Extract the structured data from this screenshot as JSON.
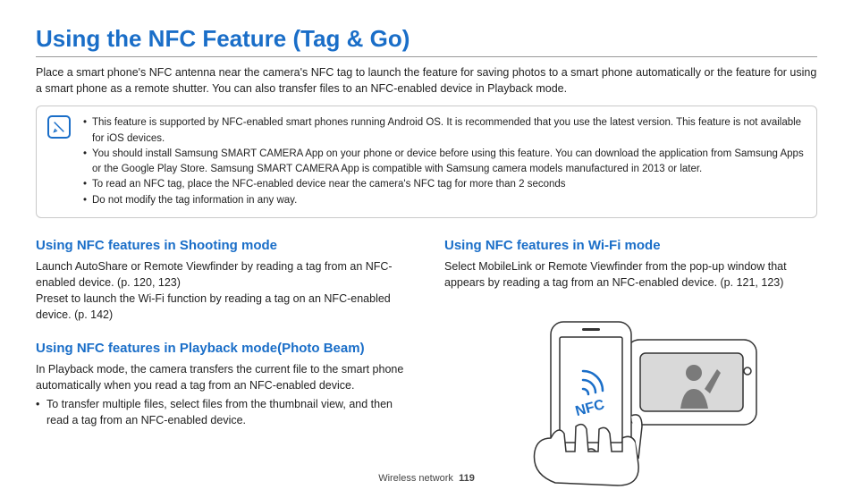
{
  "title": "Using the NFC Feature (Tag & Go)",
  "intro": "Place a smart phone's NFC antenna near the camera's NFC tag to launch the feature for saving photos to a smart phone automatically or the feature for using a smart phone as a remote shutter. You can also transfer files to an NFC-enabled device in Playback mode.",
  "notes": [
    "This feature is supported by NFC-enabled smart phones running Android OS. It is recommended that you use the latest version. This feature is not available for iOS devices.",
    "You should install Samsung SMART CAMERA App on your phone or device before using this feature. You can download the application from Samsung Apps or the Google Play Store. Samsung SMART CAMERA App is compatible with Samsung camera models manufactured in 2013 or later.",
    "To read an NFC tag, place the NFC-enabled device near the camera's NFC tag for more than 2 seconds",
    "Do not modify the tag information in any way."
  ],
  "left": {
    "section1": {
      "title": "Using NFC features in Shooting mode",
      "body1": "Launch AutoShare or Remote Viewfinder by reading a tag from an NFC-enabled device. (p. 120, 123)",
      "body2": "Preset to launch the Wi-Fi function by reading a tag on an NFC-enabled device. (p. 142)"
    },
    "section2": {
      "title": "Using NFC features in Playback mode(Photo Beam)",
      "body1": "In Playback mode, the camera transfers the current file to the smart phone automatically when you read a tag from an NFC-enabled device.",
      "bullet1": "To transfer multiple files, select files from the thumbnail view, and then read a tag from an NFC-enabled device."
    }
  },
  "right": {
    "section1": {
      "title": "Using NFC features in Wi-Fi mode",
      "body1": "Select MobileLink or Remote Viewfinder from the pop-up window that appears by reading a tag from an NFC-enabled device. (p. 121, 123)"
    }
  },
  "nfc_label": "NFC",
  "footer": {
    "section": "Wireless network",
    "page": "119"
  }
}
